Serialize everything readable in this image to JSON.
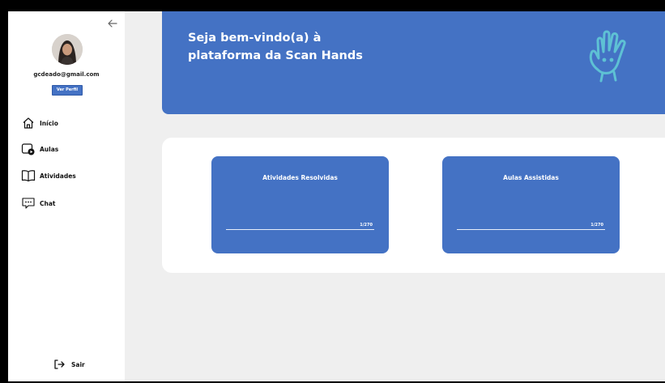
{
  "sidebar": {
    "email": "gcdeado@gmail.com",
    "profile_button": "Ver Perfil",
    "items": [
      {
        "label": "Início",
        "icon": "home-icon"
      },
      {
        "label": "Aulas",
        "icon": "video-icon"
      },
      {
        "label": "Atividades",
        "icon": "book-icon"
      },
      {
        "label": "Chat",
        "icon": "chat-icon"
      }
    ],
    "logout": "Sair"
  },
  "banner": {
    "line1": "Seja bem-vindo(a) à",
    "line2": "plataforma da Scan Hands"
  },
  "stats": [
    {
      "title": "Atividades Resolvidas",
      "count": "1/270"
    },
    {
      "title": "Aulas Assistidas",
      "count": "1/270"
    }
  ],
  "colors": {
    "brand_blue": "#4472c4",
    "logo_cyan": "#5ec1d4",
    "page_bg": "#efefef"
  }
}
